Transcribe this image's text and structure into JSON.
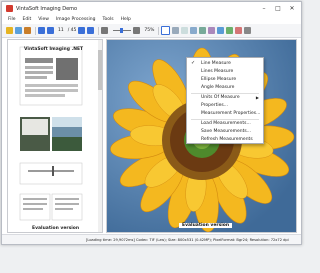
{
  "window": {
    "title": "VintaSoft Imaging Demo",
    "controls": [
      "–",
      "□",
      "✕"
    ]
  },
  "menubar": {
    "items": [
      "File",
      "Edit",
      "View",
      "Image Processing",
      "Tools",
      "Help"
    ]
  },
  "toolbar": {
    "page_current": "11",
    "page_total": "/ 45",
    "zoom_value": "75%"
  },
  "sidebar": {
    "thumbnails": [
      {
        "caption": "VintaSoft Imaging .NET"
      },
      {
        "caption": ""
      },
      {
        "caption": ""
      },
      {
        "caption": ""
      },
      {
        "caption": ""
      },
      {
        "caption": "Evaluation version"
      }
    ]
  },
  "viewer": {
    "evaluation_banner": "Evaluation version"
  },
  "measure_menu": {
    "items": [
      {
        "label": "Line Measure",
        "checked": true
      },
      {
        "label": "Lines Measure",
        "checked": false
      },
      {
        "label": "Ellipse Measure",
        "checked": false
      },
      {
        "label": "Angle Measure",
        "checked": false
      },
      {
        "label": "Units Of Measure",
        "submenu": true
      },
      {
        "label": "Properties..."
      },
      {
        "label": "Measurement Properties..."
      },
      {
        "label": "Load Measurements..."
      },
      {
        "label": "Save Measurements..."
      },
      {
        "label": "Refresh Measurements"
      }
    ]
  },
  "statusbar": {
    "text": "[Loading time: 29,9072ms]  Codec: TIF (Lzw); Size: 800x531 (0.42MP); PixelFormat: Bgr24; Resolution: 72x72 dpi"
  },
  "colors": {
    "accent": "#3a6fd8",
    "viewer_bg": "#5a7ea5",
    "sunflower_petal": "#f4b81f",
    "sunflower_center": "#6b3a12"
  }
}
